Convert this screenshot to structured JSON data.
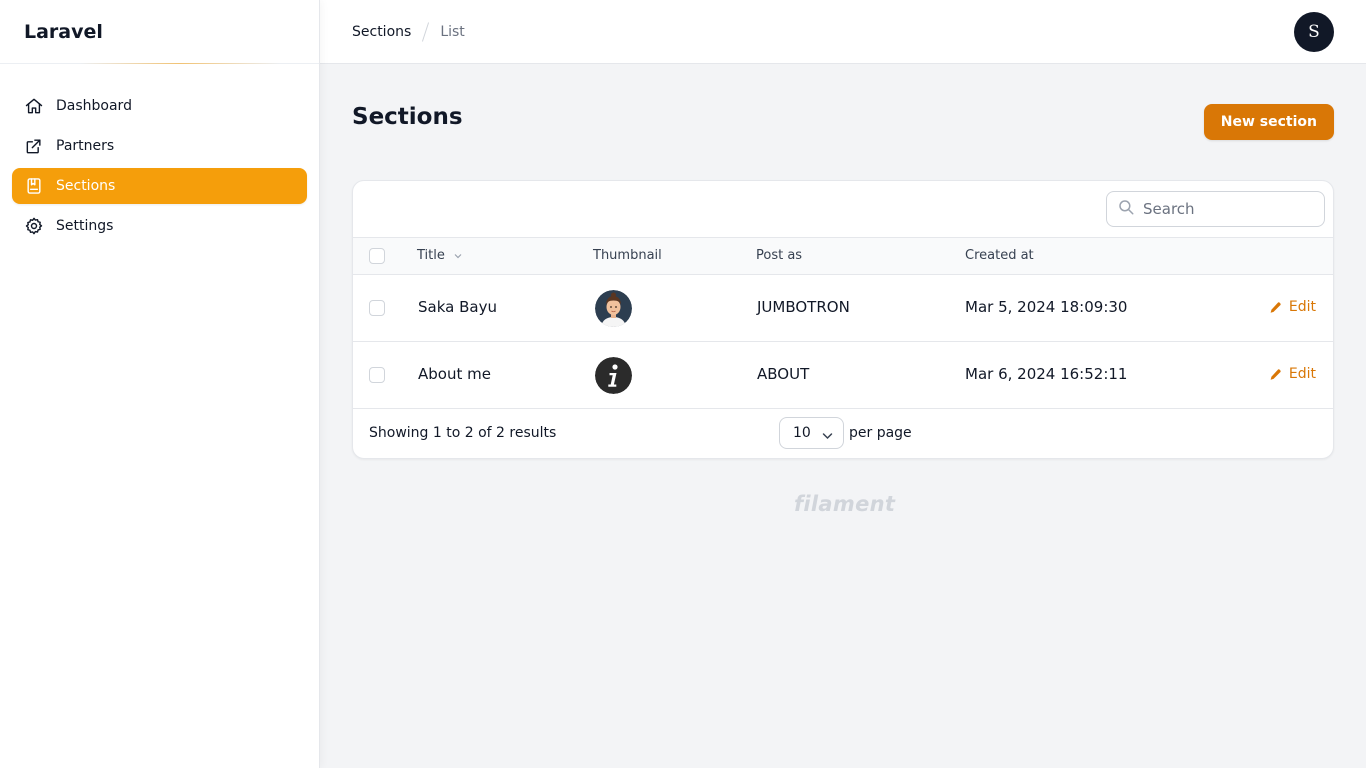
{
  "app": {
    "brand": "Laravel"
  },
  "sidebar": {
    "items": [
      {
        "label": "Dashboard",
        "icon": "home-icon",
        "active": false
      },
      {
        "label": "Partners",
        "icon": "external-link-icon",
        "active": false
      },
      {
        "label": "Sections",
        "icon": "book-icon",
        "active": true
      },
      {
        "label": "Settings",
        "icon": "gear-icon",
        "active": false
      }
    ]
  },
  "header": {
    "breadcrumbs": [
      "Sections",
      "List"
    ],
    "avatar_initial": "S"
  },
  "page": {
    "title": "Sections",
    "new_button_label": "New section"
  },
  "table": {
    "search_placeholder": "Search",
    "columns": [
      "Title",
      "Thumbnail",
      "Post as",
      "Created at"
    ],
    "rows": [
      {
        "title": "Saka Bayu",
        "thumbnail": "avatar-person-icon",
        "post_as": "JUMBOTRON",
        "created_at": "Mar 5, 2024 18:09:30",
        "action": "Edit"
      },
      {
        "title": "About me",
        "thumbnail": "info-icon",
        "post_as": "ABOUT",
        "created_at": "Mar 6, 2024 16:52:11",
        "action": "Edit"
      }
    ],
    "showing_text": "Showing 1 to 2 of 2 results",
    "per_page_value": "10",
    "per_page_label": "per page"
  },
  "footer": {
    "watermark": "filament"
  },
  "colors": {
    "accent": "#f59e0b",
    "accent_dark": "#d97706",
    "text": "#111827",
    "muted": "#6b7280",
    "background": "#f3f4f6"
  }
}
